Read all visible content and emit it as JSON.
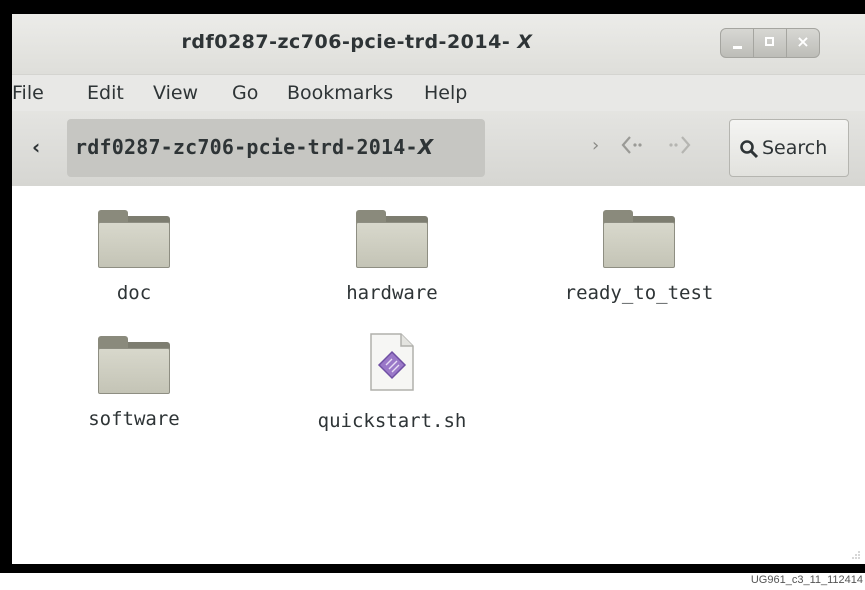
{
  "window": {
    "title_main": "rdf0287-zc706-pcie-trd-2014-",
    "title_suffix": "X",
    "minimize_label": "_",
    "close_label": "×"
  },
  "menubar": {
    "items": [
      "File",
      "Edit",
      "View",
      "Go",
      "Bookmarks",
      "Help"
    ]
  },
  "toolbar": {
    "back_label": "‹",
    "path_main": "rdf0287-zc706-pcie-trd-2014-",
    "path_suffix": "X",
    "forward_label": "›",
    "search_label": "Search"
  },
  "files": [
    {
      "name": "doc",
      "type": "folder"
    },
    {
      "name": "hardware",
      "type": "folder"
    },
    {
      "name": "ready_to_test",
      "type": "folder"
    },
    {
      "name": "software",
      "type": "folder"
    },
    {
      "name": "quickstart.sh",
      "type": "script"
    }
  ],
  "caption": "UG961_c3_11_112414"
}
